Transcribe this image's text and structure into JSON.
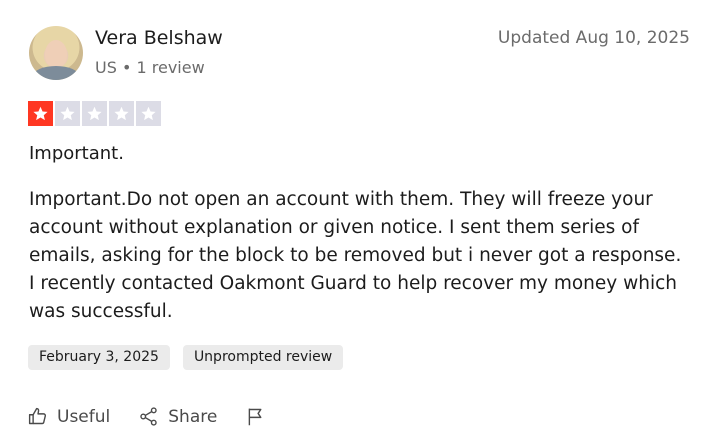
{
  "reviewer": {
    "name": "Vera Belshaw",
    "country": "US",
    "separator": "•",
    "review_count": "1 review"
  },
  "updated_label": "Updated Aug 10, 2025",
  "rating": {
    "value": 1,
    "max": 5
  },
  "review": {
    "title": "Important.",
    "body": "Important.Do not open an account with them. They will freeze your account without explanation or given notice. I sent them series of emails, asking for the block to be removed but i never got a response. I recently contacted Oakmont Guard to help recover my money which was successful."
  },
  "chips": {
    "date": "February 3, 2025",
    "type": "Unprompted review"
  },
  "actions": {
    "useful": "Useful",
    "share": "Share"
  },
  "colors": {
    "star_filled": "#ff3722",
    "star_empty": "#dcdce6"
  }
}
